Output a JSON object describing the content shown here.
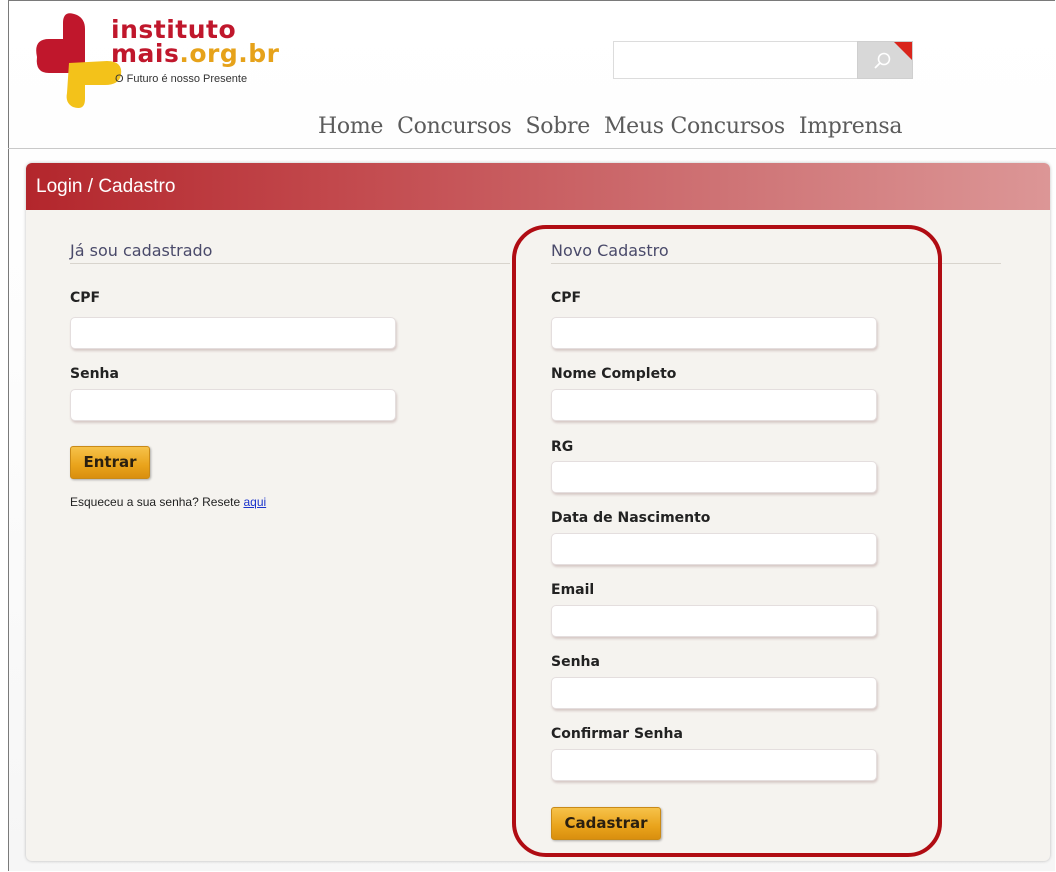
{
  "logo": {
    "line1": "instituto",
    "line2_main": "mais",
    "line2_suffix": ".org.br",
    "tagline": "O Futuro é nosso Presente",
    "colors": {
      "red": "#c0172c",
      "yellow": "#f3c21a",
      "orange": "#e6a21a"
    }
  },
  "search": {
    "icon": "search-icon",
    "placeholder": ""
  },
  "nav": {
    "items": [
      {
        "label": "Home"
      },
      {
        "label": "Concursos"
      },
      {
        "label": "Sobre"
      },
      {
        "label": "Meus Concursos"
      },
      {
        "label": "Imprensa"
      }
    ]
  },
  "panel": {
    "title": "Login / Cadastro",
    "colors": {
      "header_start": "#b3262c",
      "header_end": "#dc9696",
      "button": "#e9a31b",
      "highlight": "#b00c13"
    }
  },
  "login": {
    "heading": "Já sou cadastrado",
    "cpf_label": "CPF",
    "cpf_value": "",
    "senha_label": "Senha",
    "senha_value": "",
    "submit_label": "Entrar",
    "forgot_text": "Esqueceu a sua senha? Resete ",
    "forgot_link": "aqui"
  },
  "register": {
    "heading": "Novo Cadastro",
    "fields": [
      {
        "label": "CPF",
        "value": ""
      },
      {
        "label": "Nome Completo",
        "value": ""
      },
      {
        "label": "RG",
        "value": ""
      },
      {
        "label": "Data de Nascimento",
        "value": ""
      },
      {
        "label": "Email",
        "value": ""
      },
      {
        "label": "Senha",
        "value": ""
      },
      {
        "label": "Confirmar Senha",
        "value": ""
      }
    ],
    "submit_label": "Cadastrar"
  }
}
